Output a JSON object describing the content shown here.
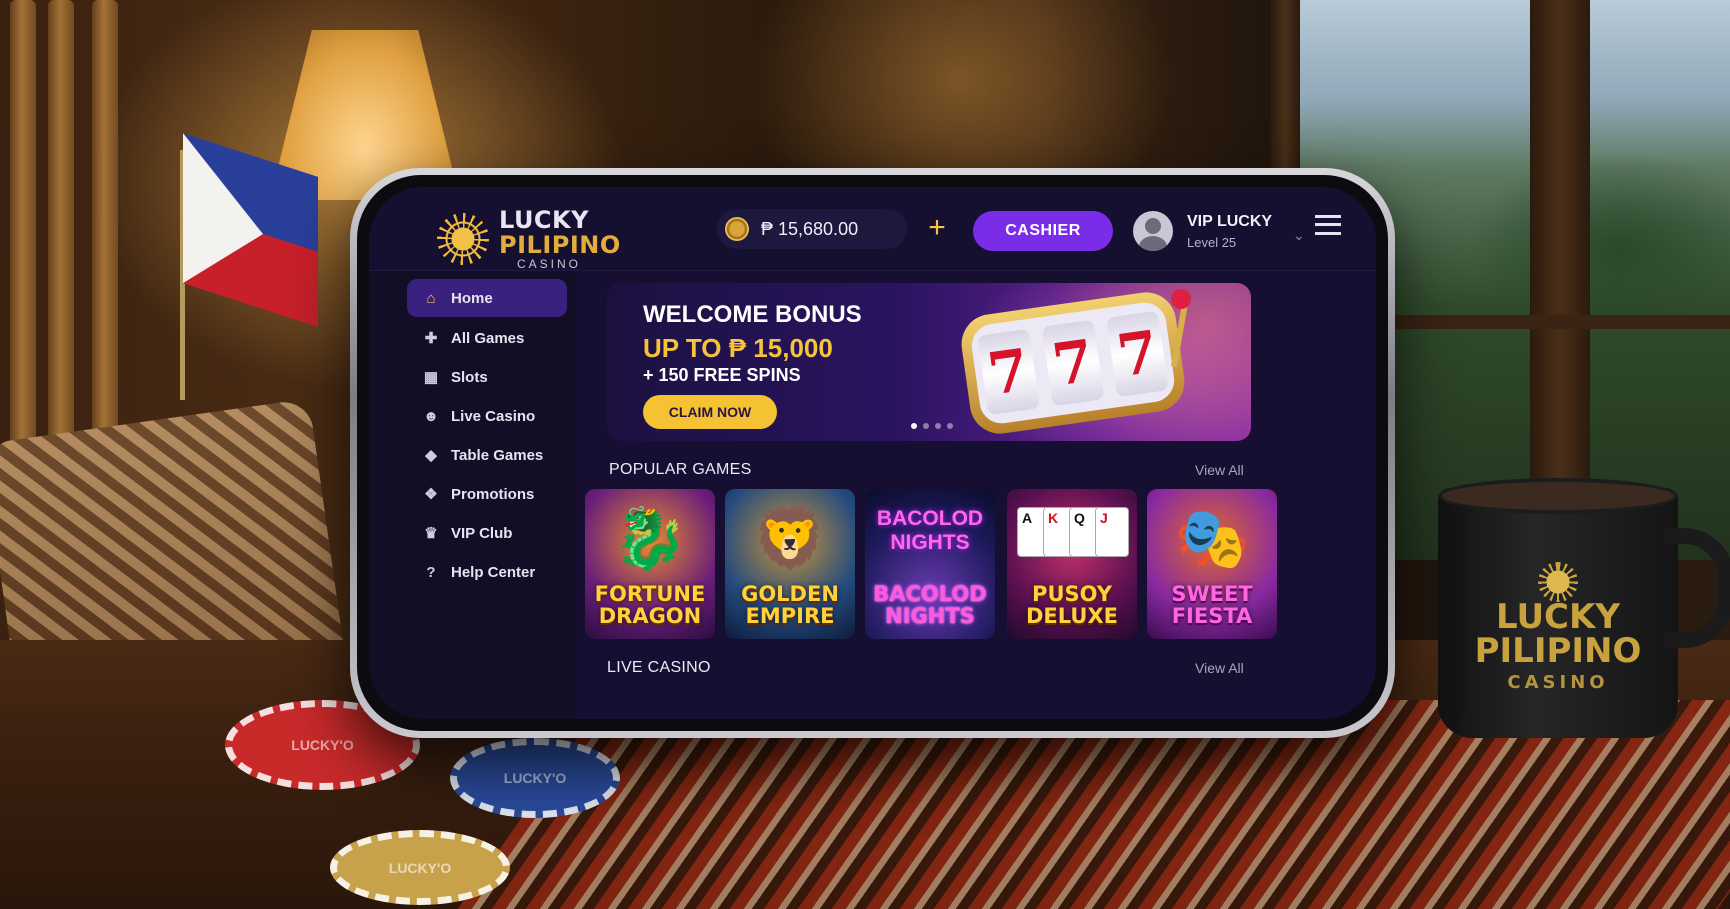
{
  "app": {
    "logo": {
      "line1": "LUCKY",
      "line2": "PILIPINO",
      "line3": "CASINO"
    },
    "balance": "₱ 15,680.00",
    "add_funds_symbol": "+",
    "cashier_label": "CASHIER",
    "user": {
      "name": "VIP LUCKY",
      "level": "Level 25"
    }
  },
  "sidebar": {
    "items": [
      {
        "label": "Home",
        "icon": "home-icon",
        "active": true
      },
      {
        "label": "All Games",
        "icon": "gamepad-icon"
      },
      {
        "label": "Slots",
        "icon": "slots-icon"
      },
      {
        "label": "Live Casino",
        "icon": "users-icon"
      },
      {
        "label": "Table Games",
        "icon": "diamond-icon"
      },
      {
        "label": "Promotions",
        "icon": "gift-icon"
      },
      {
        "label": "VIP Club",
        "icon": "crown-icon"
      },
      {
        "label": "Help Center",
        "icon": "help-icon"
      }
    ]
  },
  "banner": {
    "title": "WELCOME BONUS",
    "subtitle": "UP TO ₱ 15,000",
    "extra": "+ 150 FREE SPINS",
    "cta": "CLAIM NOW",
    "reels": [
      "7",
      "7",
      "7"
    ]
  },
  "popular": {
    "title": "POPULAR GAMES",
    "view_all": "View All",
    "games": [
      {
        "title": "FORTUNE\nDRAGON",
        "icon": "dragon-icon"
      },
      {
        "title": "GOLDEN\nEMPIRE",
        "icon": "lion-icon"
      },
      {
        "title": "BACOLOD\nNIGHTS",
        "art_text": "BACOLOD\nNIGHTS",
        "icon": "neon-city-icon"
      },
      {
        "title": "PUSOY\nDELUXE",
        "cards": [
          "A",
          "K",
          "Q",
          "J"
        ],
        "icon": "cards-icon"
      },
      {
        "title": "SWEET\nFIESTA",
        "icon": "mask-icon"
      }
    ]
  },
  "live": {
    "title": "LIVE CASINO",
    "view_all": "View All"
  },
  "scene": {
    "mug": {
      "line1": "LUCKY",
      "line2": "PILIPINO",
      "line3": "CASINO"
    },
    "chip_text": "LUCKY'O"
  },
  "colors": {
    "accent_purple": "#7b2ce8",
    "gold": "#f4c232",
    "screen_bg": "#160f32"
  }
}
